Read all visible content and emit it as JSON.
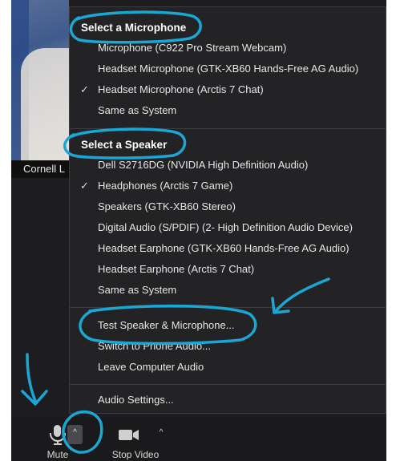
{
  "participant": {
    "name": "Cornell L"
  },
  "menu": {
    "mic_heading": "Select a Microphone",
    "microphones": [
      {
        "label": "Microphone (C922 Pro Stream Webcam)",
        "checked": false
      },
      {
        "label": "Headset Microphone (GTK-XB60 Hands-Free AG Audio)",
        "checked": false
      },
      {
        "label": "Headset Microphone (Arctis 7 Chat)",
        "checked": true
      },
      {
        "label": "Same as System",
        "checked": false
      }
    ],
    "speaker_heading": "Select a Speaker",
    "speakers": [
      {
        "label": "Dell S2716DG (NVIDIA High Definition Audio)",
        "checked": false
      },
      {
        "label": "Headphones (Arctis 7 Game)",
        "checked": true
      },
      {
        "label": "Speakers (GTK-XB60 Stereo)",
        "checked": false
      },
      {
        "label": "Digital Audio (S/PDIF) (2- High Definition Audio Device)",
        "checked": false
      },
      {
        "label": "Headset Earphone (GTK-XB60 Hands-Free AG Audio)",
        "checked": false
      },
      {
        "label": "Headset Earphone (Arctis 7 Chat)",
        "checked": false
      },
      {
        "label": "Same as System",
        "checked": false
      }
    ],
    "test_label": "Test Speaker & Microphone...",
    "switch_label": "Switch to Phone Audio...",
    "leave_label": "Leave Computer Audio",
    "settings_label": "Audio Settings...",
    "check_glyph": "✓"
  },
  "toolbar": {
    "mute_label": "Mute",
    "stop_video_label": "Stop Video",
    "caret_glyph": "^"
  },
  "colors": {
    "annotation": "#1aa7d4",
    "menu_bg": "#232325",
    "toolbar_bg": "#1a1a1c"
  }
}
